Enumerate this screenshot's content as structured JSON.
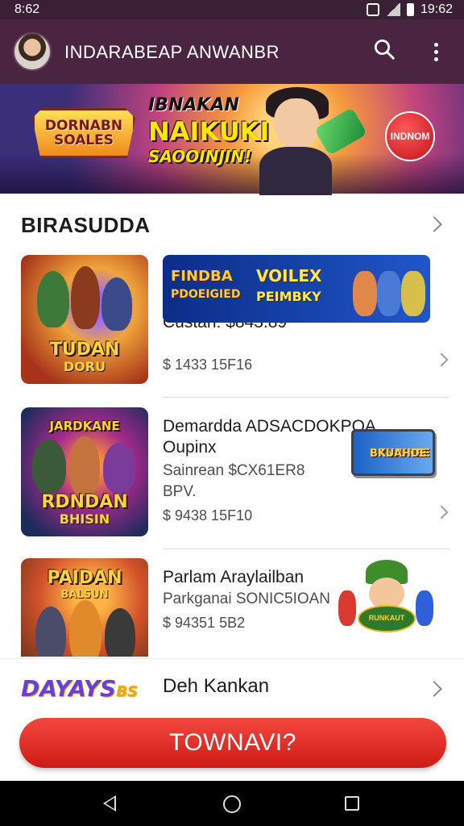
{
  "status_bar": {
    "left_text": "8:62",
    "time": "19:62"
  },
  "app_bar": {
    "title": "INDARABEAP ANWANBR"
  },
  "banner": {
    "badge_line1": "DORNABN",
    "badge_line2": "SOALES",
    "headline_line1": "IBNAKAN",
    "headline_line2": "NAIKUKI",
    "headline_line3": "SAOOINJIN!",
    "side_badge": "INDNOM"
  },
  "section": {
    "title": "BIRASUDDA"
  },
  "items": [
    {
      "thumb_title": "TUDAN",
      "thumb_sub": "DORU",
      "promo_left": "FINDBA",
      "promo_left_2": "PDOEIGIED",
      "promo_right": "VOILEX",
      "promo_right_2": "PEIMBKY",
      "title": "Custan: $843.89",
      "subtitle": "",
      "price": "$ 1433 15F16"
    },
    {
      "thumb_title": "RDNDAN",
      "thumb_sub": "BHISIN",
      "thumb_top": "JARDKANE",
      "title": "Demardda ADSACDOKPOA",
      "title_2": "Oupinx",
      "subtitle": "Sainrean $CX61ER8",
      "subtitle_2": "BPV.",
      "price": "$ 9438 15F10",
      "side_card_1": "BRNIUNEE",
      "side_card_2": "BKUAHDE"
    },
    {
      "thumb_title": "PAIDAN",
      "thumb_sub": "BALSUN",
      "title": "Parlam Araylailban",
      "subtitle": "Parkganai SONIC5IOAN",
      "price": "$ 94351 5B2",
      "mascot_text": "RUNKAUT"
    }
  ],
  "bottom_row": {
    "logo": "DAYAYS",
    "logo_suffix": "BS",
    "label": "Deh Kankan"
  },
  "cta": {
    "label": "TOWNAVI?"
  },
  "colors": {
    "app_bar": "#4a2541",
    "cta": "#e2302a",
    "accent_yellow": "#ffd43b"
  }
}
